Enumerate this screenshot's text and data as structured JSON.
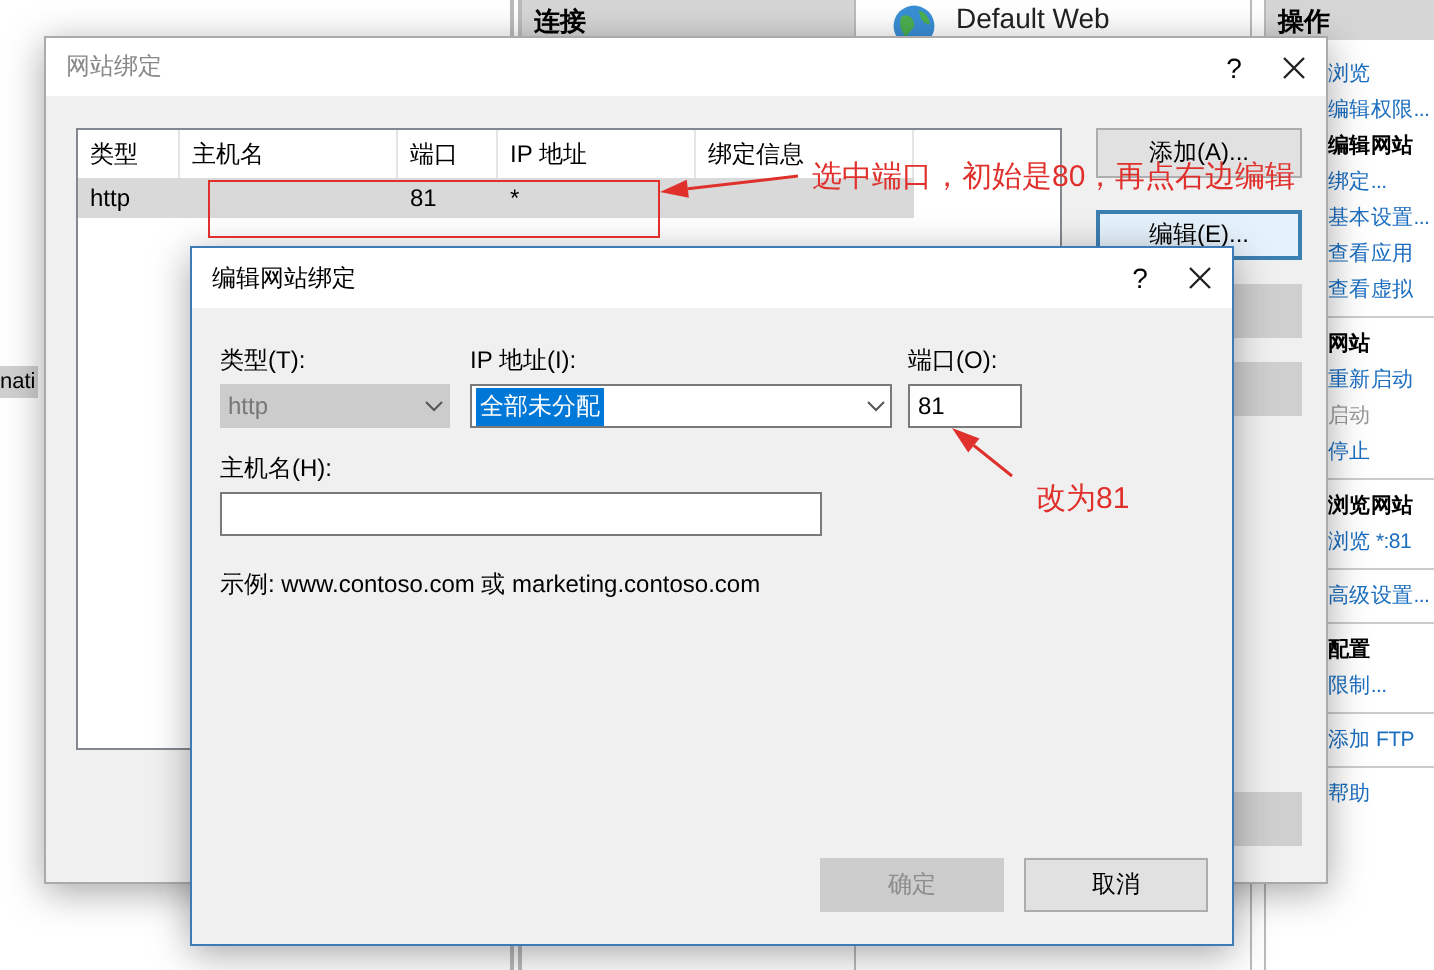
{
  "background": {
    "connections_header": "连接",
    "site_title": "Default Web",
    "left_fragment": "nati",
    "actions_header": "操作",
    "actions": [
      {
        "label": "浏览",
        "kind": "link"
      },
      {
        "label": "编辑权限...",
        "kind": "link"
      },
      {
        "label": "编辑网站",
        "kind": "header"
      },
      {
        "label": "绑定...",
        "kind": "link"
      },
      {
        "label": "基本设置...",
        "kind": "link"
      },
      {
        "label": "查看应用",
        "kind": "link"
      },
      {
        "label": "查看虚拟",
        "kind": "link",
        "separator": true
      },
      {
        "label": "网站",
        "kind": "header"
      },
      {
        "label": "重新启动",
        "kind": "link"
      },
      {
        "label": "启动",
        "kind": "disabled"
      },
      {
        "label": "停止",
        "kind": "link",
        "separator": true
      },
      {
        "label": "浏览网站",
        "kind": "header"
      },
      {
        "label": "浏览 *:81",
        "kind": "link",
        "separator": true
      },
      {
        "label": "高级设置...",
        "kind": "link",
        "separator": true
      },
      {
        "label": "配置",
        "kind": "header"
      },
      {
        "label": "限制...",
        "kind": "link",
        "separator": true
      },
      {
        "label": "添加 FTP",
        "kind": "link",
        "separator": true
      },
      {
        "label": "帮助",
        "kind": "link"
      }
    ]
  },
  "bindings_dialog": {
    "title": "网站绑定",
    "help": "?",
    "columns": [
      "类型",
      "主机名",
      "端口",
      "IP 地址",
      "绑定信息"
    ],
    "rows": [
      {
        "cells": [
          "http",
          "",
          "81",
          "*",
          ""
        ],
        "selected": true
      }
    ],
    "buttons": [
      {
        "label": "添加(A)...",
        "kind": "normal"
      },
      {
        "label": "编辑(E)...",
        "kind": "focused"
      },
      {
        "kind": "blank"
      },
      {
        "kind": "blank"
      },
      {
        "kind": "blank"
      }
    ]
  },
  "edit_dialog": {
    "title": "编辑网站绑定",
    "help": "?",
    "type_label": "类型(T):",
    "type_value": "http",
    "type_disabled": true,
    "ip_label": "IP 地址(I):",
    "ip_value": "全部未分配",
    "ip_selected": true,
    "port_label": "端口(O):",
    "port_value": "81",
    "host_label": "主机名(H):",
    "example": "示例: www.contoso.com 或 marketing.contoso.com",
    "buttons": [
      {
        "label": "确定",
        "disabled": true
      },
      {
        "label": "取消",
        "disabled": false
      }
    ]
  },
  "annotations": [
    {
      "text": "选中端口，初始是80，再点右边编辑"
    },
    {
      "text": "改为81"
    }
  ]
}
